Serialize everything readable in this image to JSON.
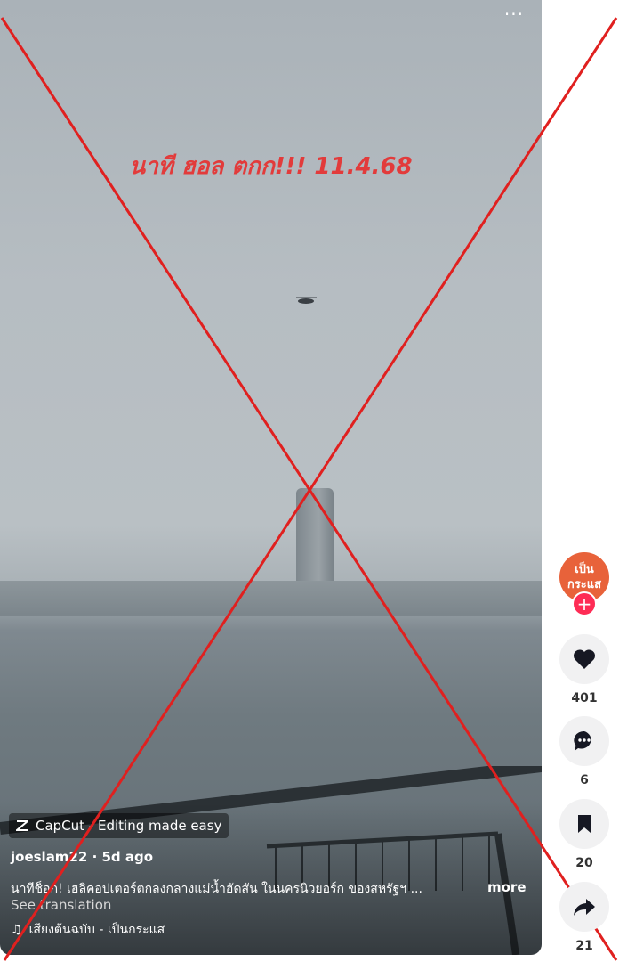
{
  "video": {
    "overlay_text": "นาที ฮอล ตกก!!! 11.4.68",
    "more_options": "···",
    "capcut_label": "CapCut - Editing made easy",
    "author": "joeslam22",
    "posted": "5d ago",
    "caption": "นาทีช็อก! เฮลิคอปเตอร์ตกลงกลางแม่น้ำฮัดสัน ในนครนิวยอร์ก ของสหรัฐฯ ...",
    "more_label": "more",
    "see_translation": "See translation",
    "sound": "เสียงต้นฉบับ - เป็นกระแส"
  },
  "sidebar": {
    "avatar_text_line1": "เป็น",
    "avatar_text_line2": "กระแส",
    "follow_label": "+",
    "likes": "401",
    "comments": "6",
    "saves": "20",
    "shares": "21"
  },
  "colors": {
    "cross": "#e0201f",
    "accent": "#fe2c55",
    "overlay": "#e23b3b"
  }
}
